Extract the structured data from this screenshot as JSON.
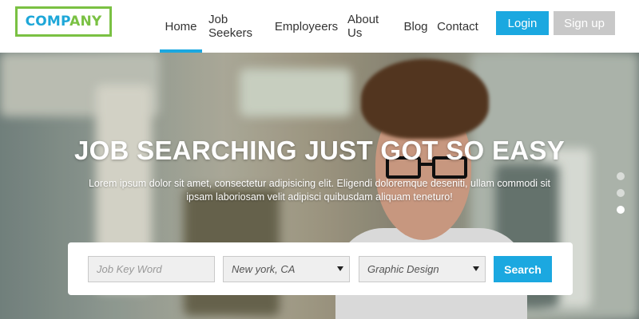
{
  "brand": {
    "name_part1": "COMP",
    "name_part2": "ANY",
    "color_primary": "#1ea7d8",
    "color_secondary": "#7ac143"
  },
  "nav": {
    "items": [
      {
        "label": "Home",
        "active": true
      },
      {
        "label": "Job Seekers",
        "active": false
      },
      {
        "label": "Employeers",
        "active": false
      },
      {
        "label": "About Us",
        "active": false
      },
      {
        "label": "Blog",
        "active": false
      },
      {
        "label": "Contact",
        "active": false
      }
    ],
    "login_label": "Login",
    "signup_label": "Sign up",
    "accent_color": "#1ba8e0"
  },
  "hero": {
    "title": "JOB SEARCHING JUST GOT SO EASY",
    "subtitle": "Lorem ipsum dolor sit amet, consectetur adipisicing elit. Eligendi doloremque deseniti, ullam commodi sit ipsam laboriosam velit adipisci quibusdam aliquam teneturo!",
    "slider_dots": 3,
    "active_dot": 3
  },
  "search": {
    "keyword_placeholder": "Job Key Word",
    "location_value": "New york, CA",
    "category_value": "Graphic Design",
    "button_label": "Search"
  }
}
